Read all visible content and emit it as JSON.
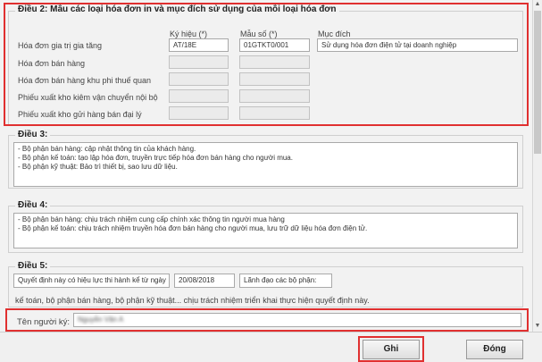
{
  "article2": {
    "title": "Điều 2: Mẫu các loại hóa đơn in và mục đích sử dụng của mỗi loại hóa đơn",
    "headers": {
      "symbol": "Ký hiệu (*)",
      "template": "Mẫu số (*)",
      "purpose": "Mục đích"
    },
    "rows": [
      {
        "label": "Hóa đơn gia trị gia tăng",
        "symbol": "AT/18E",
        "template": "01GTKT0/001",
        "purpose": "Sử dụng hóa đơn điện tử tại doanh nghiệp"
      },
      {
        "label": "Hóa đơn bán hàng",
        "symbol": "",
        "template": "",
        "purpose": ""
      },
      {
        "label": "Hóa đơn bán hàng khu phi thuế quan",
        "symbol": "",
        "template": "",
        "purpose": ""
      },
      {
        "label": "Phiếu xuất kho kiêm vận chuyển nội bộ",
        "symbol": "",
        "template": "",
        "purpose": ""
      },
      {
        "label": "Phiếu xuất kho gửi hàng bán đại lý",
        "symbol": "",
        "template": "",
        "purpose": ""
      }
    ]
  },
  "article3": {
    "title": "Điều 3:",
    "lines": [
      "- Bộ phận bán hàng: cập nhật thông tin của khách hàng.",
      "- Bộ phận kế toán: tạo lập hóa đơn, truyền trực tiếp hóa đơn bán hàng cho người mua.",
      "- Bộ phận kỹ thuật: Bảo trì thiết bị, sao lưu dữ liệu."
    ]
  },
  "article4": {
    "title": "Điều 4:",
    "lines": [
      "- Bộ phận bán hàng: chịu trách nhiệm cung cấp chính xác thông tin người mua hàng",
      "- Bộ phận kế toán: chịu trách nhiệm truyền hóa đơn bán hàng cho người mua, lưu trữ dữ liệu hóa đơn điện tử."
    ]
  },
  "article5": {
    "title": "Điều 5:",
    "effective_label": "Quyết định này có hiệu lực thi hành kể từ ngày",
    "effective_date": "20/08/2018",
    "leaders_label": "Lãnh đạo các bộ phận:",
    "responsibility_text": "kế toán, bộ phận bán hàng, bộ phận kỹ thuật... chịu trách nhiệm triển khai thực hiện quyết định này."
  },
  "signer": {
    "label": "Tên người ký:",
    "value": "Nguyễn Văn A"
  },
  "buttons": {
    "save": "Ghi",
    "close": "Đóng"
  },
  "colors": {
    "highlight": "#e03030",
    "panel": "#f2f2f2"
  }
}
